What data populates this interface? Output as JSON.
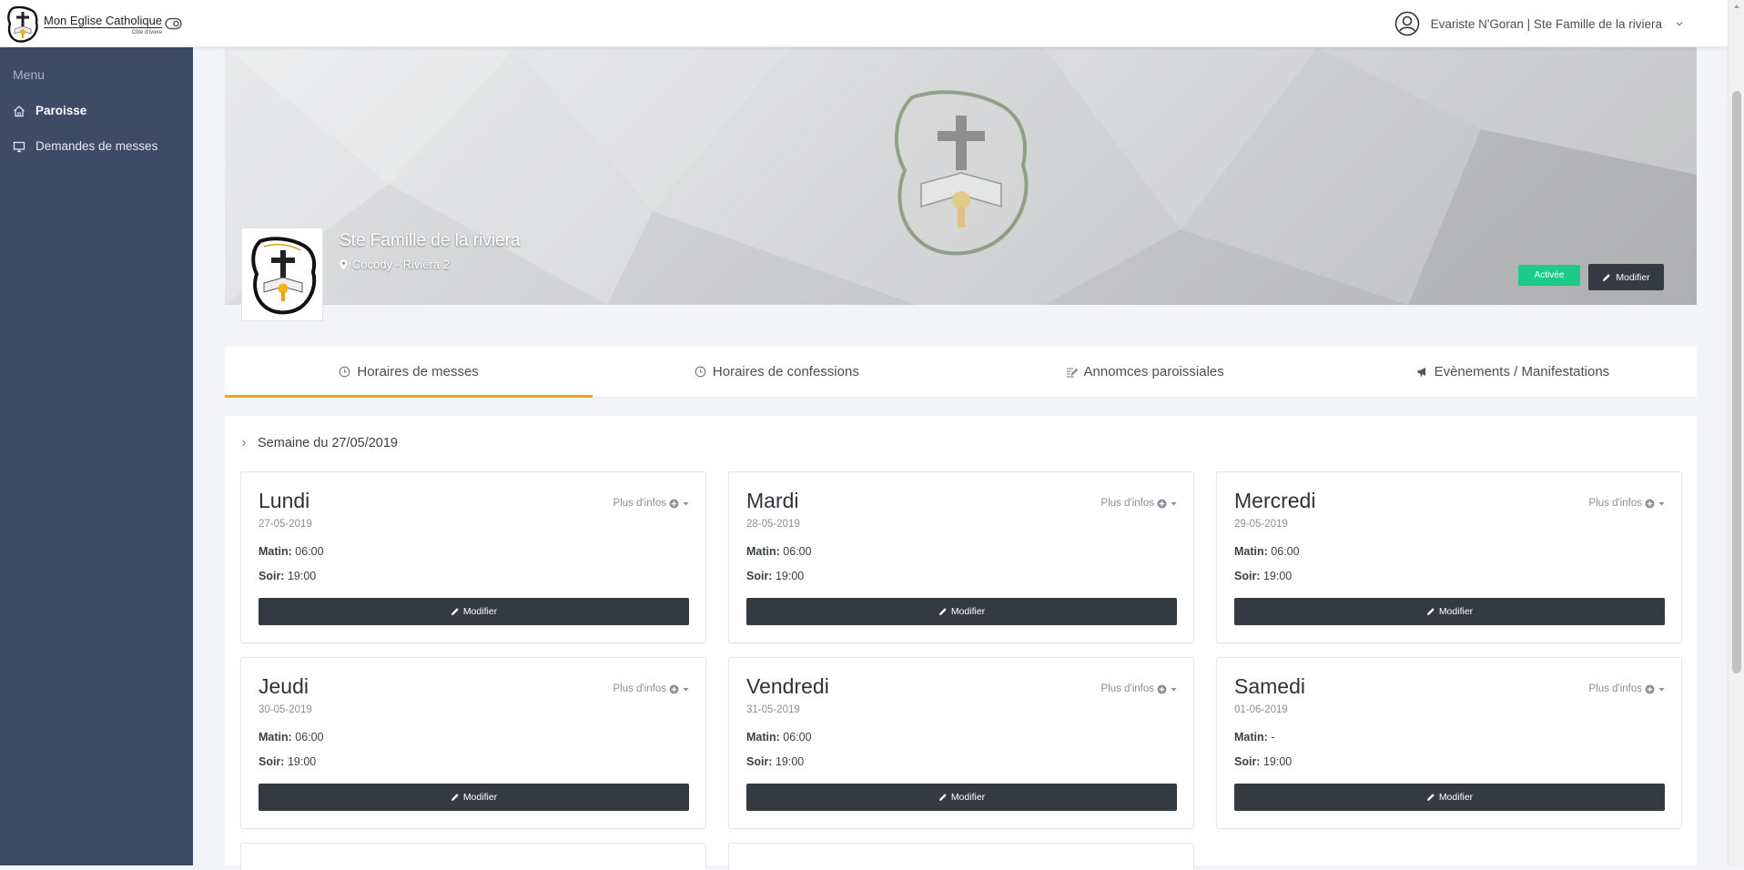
{
  "header": {
    "logo_title": "Mon Eglise Catholique",
    "logo_subtitle": "Côte d'Ivoire",
    "user_label": "Evariste N'Goran | Ste Famille de la riviera"
  },
  "sidebar": {
    "menu_header": "Menu",
    "items": [
      {
        "label": "Paroisse",
        "icon": "home-icon",
        "active": true
      },
      {
        "label": "Demandes de messes",
        "icon": "monitor-icon",
        "active": false
      }
    ]
  },
  "banner": {
    "parish_name": "Ste Famille de la riviera",
    "location": "Cocody - Riviéra 2",
    "status_badge": "Activée",
    "modify_label": "Modifier"
  },
  "tabs": [
    {
      "label": "Horaires de messes",
      "icon": "clock-icon",
      "active": true
    },
    {
      "label": "Horaires de confessions",
      "icon": "clock-icon",
      "active": false
    },
    {
      "label": "Annomces paroissiales",
      "icon": "edit-icon",
      "active": false
    },
    {
      "label": "Evènements / Manifestations",
      "icon": "megaphone-icon",
      "active": false
    }
  ],
  "week": {
    "title": "Semaine du 27/05/2019",
    "more_info_label": "Plus d'infos",
    "matin_label": "Matin:",
    "soir_label": "Soir:",
    "modify_label": "Modifier",
    "days": [
      {
        "name": "Lundi",
        "date": "27-05-2019",
        "matin": "06:00",
        "soir": "19:00"
      },
      {
        "name": "Mardi",
        "date": "28-05-2019",
        "matin": "06:00",
        "soir": "19:00"
      },
      {
        "name": "Mercredi",
        "date": "29-05-2019",
        "matin": "06:00",
        "soir": "19:00"
      },
      {
        "name": "Jeudi",
        "date": "30-05-2019",
        "matin": "06:00",
        "soir": "19:00"
      },
      {
        "name": "Vendredi",
        "date": "31-05-2019",
        "matin": "06:00",
        "soir": "19:00"
      },
      {
        "name": "Samedi",
        "date": "01-06-2019",
        "matin": "-",
        "soir": "19:00"
      }
    ]
  },
  "colors": {
    "sidebar_bg": "#3d4b65",
    "accent_tab": "#f0a40d",
    "badge_green": "#1ccb8a",
    "button_dark": "#343a40"
  }
}
